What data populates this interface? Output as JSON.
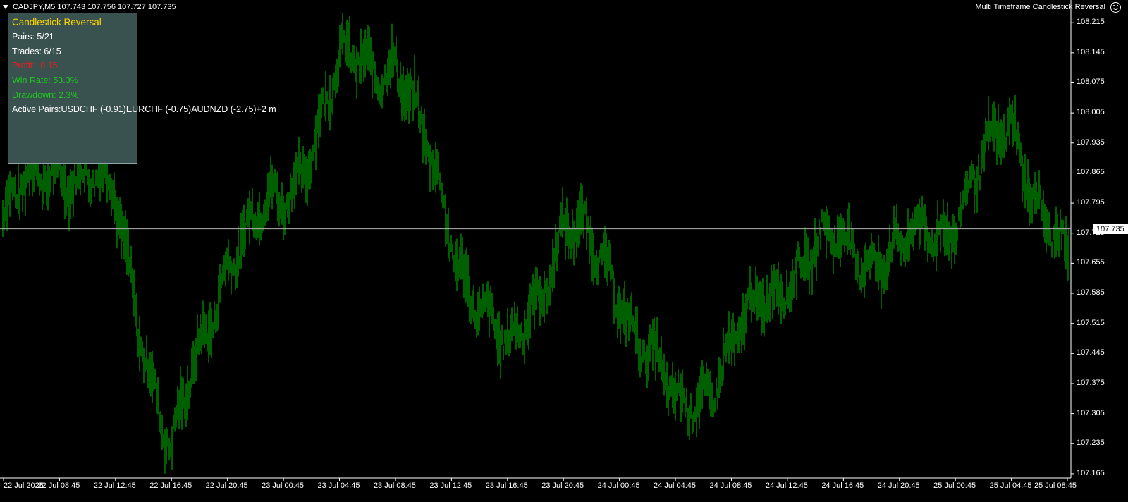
{
  "header": {
    "symbol_line": "CADJPY,M5  107.743 107.756 107.727 107.735",
    "ea_title": "Multi Timeframe Candlestick Reversal"
  },
  "panel": {
    "title": "Candlestick Reversal",
    "pairs": "Pairs: 5/21",
    "trades": "Trades: 6/15",
    "profit": "Profit: -0.15",
    "win_rate": "Win Rate: 53.3%",
    "drawdown": "Drawdown: 2.3%",
    "active_pairs": "Active Pairs:USDCHF (-0.91)EURCHF (-0.75)AUDNZD (-2.75)+2 m"
  },
  "colors": {
    "background": "#000000",
    "candle": "#00c000",
    "panel_bg": "#39514f",
    "title": "#ffd700",
    "profit": "#e02020",
    "positive": "#1ec81e",
    "axis": "#ffffff"
  },
  "price_axis": {
    "labels": [
      "108.215",
      "108.145",
      "108.075",
      "108.005",
      "107.935",
      "107.865",
      "107.795",
      "107.725",
      "107.655",
      "107.585",
      "107.515",
      "107.445",
      "107.375",
      "107.305",
      "107.235",
      "107.165"
    ],
    "current_price": "107.735"
  },
  "time_axis": {
    "labels": [
      "22 Jul 2025",
      "22 Jul 08:45",
      "22 Jul 12:45",
      "22 Jul 16:45",
      "22 Jul 20:45",
      "23 Jul 00:45",
      "23 Jul 04:45",
      "23 Jul 08:45",
      "23 Jul 12:45",
      "23 Jul 16:45",
      "23 Jul 20:45",
      "24 Jul 00:45",
      "24 Jul 04:45",
      "24 Jul 08:45",
      "24 Jul 12:45",
      "24 Jul 16:45",
      "24 Jul 20:45",
      "25 Jul 00:45",
      "25 Jul 04:45",
      "25 Jul 08:45"
    ]
  },
  "chart_data": {
    "type": "line",
    "xlabel": "",
    "ylabel": "",
    "ylim": [
      107.155,
      108.235
    ],
    "series": [
      {
        "x": [
          "22 Jul 2025",
          "22 Jul 08:45",
          "22 Jul 12:45",
          "22 Jul 16:45",
          "22 Jul 20:45",
          "23 Jul 00:45",
          "23 Jul 04:45",
          "23 Jul 08:45",
          "23 Jul 12:45",
          "23 Jul 16:45",
          "23 Jul 20:45",
          "24 Jul 00:45",
          "24 Jul 04:45",
          "24 Jul 08:45",
          "24 Jul 12:45",
          "24 Jul 16:45",
          "24 Jul 20:45",
          "25 Jul 00:45",
          "25 Jul 04:45",
          "25 Jul 08:45"
        ],
        "values": [
          107.76,
          107.9,
          107.8,
          107.2,
          107.68,
          107.8,
          108.1,
          108.14,
          107.72,
          107.42,
          107.75,
          107.6,
          107.3,
          107.45,
          107.65,
          107.7,
          107.67,
          107.78,
          107.98,
          107.62
        ]
      }
    ]
  }
}
